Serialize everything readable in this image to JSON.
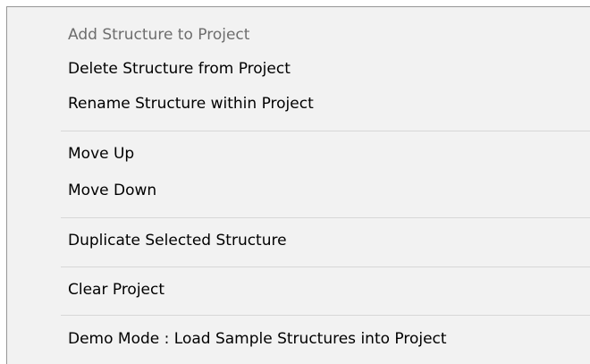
{
  "menu": {
    "items": [
      {
        "label": "Add Structure to Project",
        "disabled": true
      },
      {
        "label": "Delete Structure from Project"
      },
      {
        "label": "Rename Structure within Project"
      },
      {
        "label": "Move Up"
      },
      {
        "label": "Move Down"
      },
      {
        "label": "Duplicate Selected Structure"
      },
      {
        "label": "Clear Project"
      },
      {
        "label": "Demo Mode : Load Sample Structures into Project"
      }
    ]
  }
}
